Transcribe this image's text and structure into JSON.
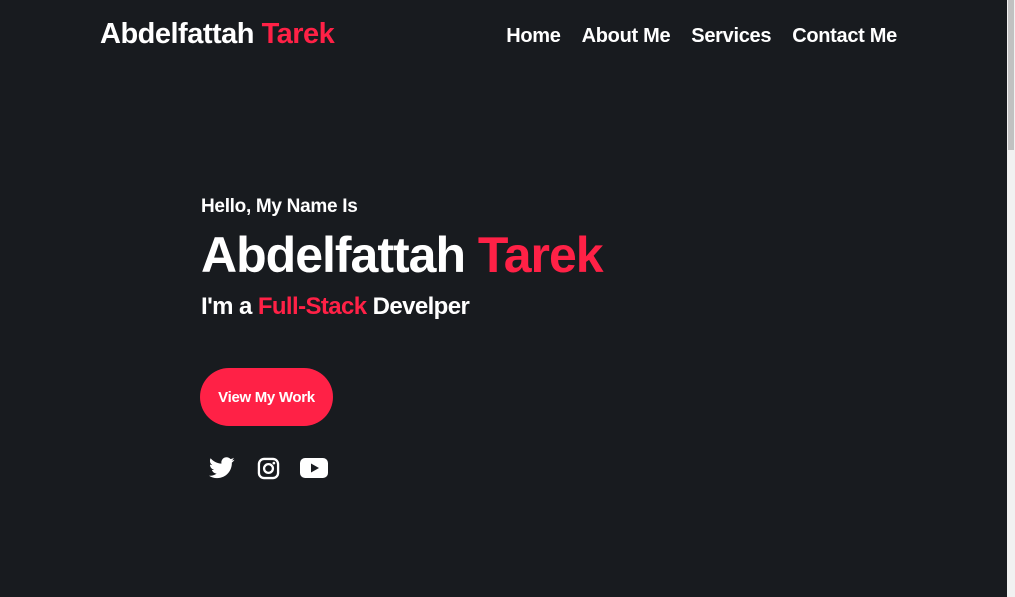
{
  "header": {
    "logo_first": "Abdelfattah",
    "logo_accent": "Tarek",
    "nav": [
      {
        "label": "Home"
      },
      {
        "label": "About Me"
      },
      {
        "label": "Services"
      },
      {
        "label": "Contact Me"
      }
    ]
  },
  "hero": {
    "greeting": "Hello, My Name Is",
    "name_first": "Abdelfattah",
    "name_accent": "Tarek",
    "role_prefix": "I'm a",
    "role_accent": "Full-Stack",
    "role_suffix": "Develper",
    "cta_label": "View My Work"
  },
  "socials": [
    {
      "icon": "twitter-icon"
    },
    {
      "icon": "instagram-icon"
    },
    {
      "icon": "youtube-icon"
    }
  ],
  "colors": {
    "background": "#181b1f",
    "accent": "#ff2146",
    "text": "#ffffff"
  }
}
